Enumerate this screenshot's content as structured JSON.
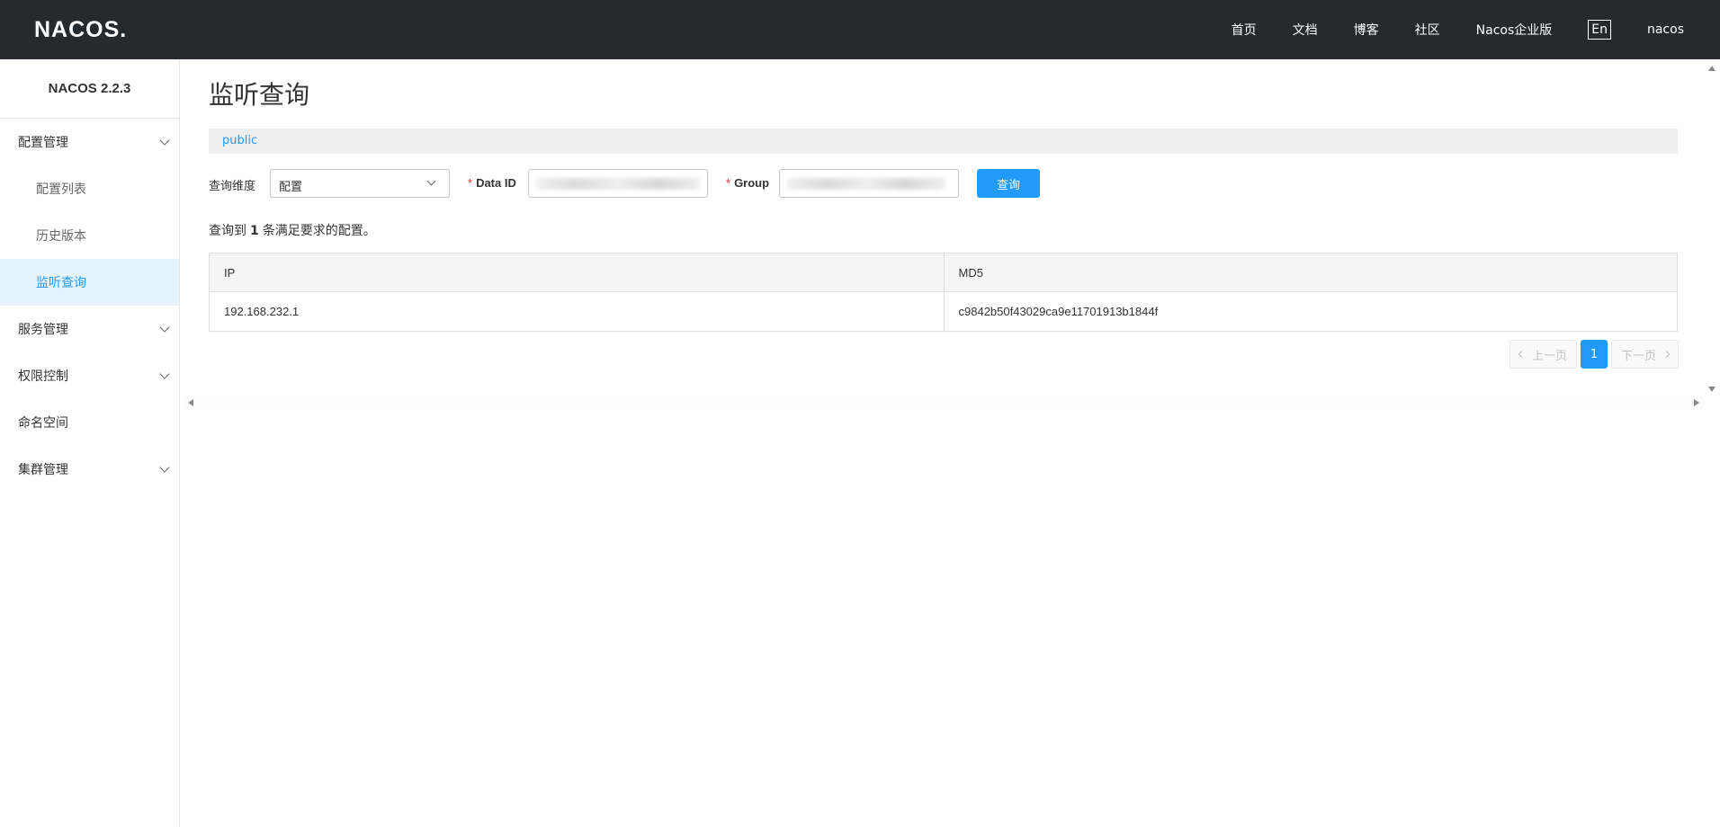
{
  "header": {
    "logo_text": "NACOS.",
    "nav": [
      "首页",
      "文档",
      "博客",
      "社区",
      "Nacos企业版"
    ],
    "lang_toggle": "En",
    "user": "nacos"
  },
  "sidebar": {
    "version": "NACOS 2.2.3",
    "groups": [
      {
        "label": "配置管理",
        "expanded": true,
        "items": [
          "配置列表",
          "历史版本",
          "监听查询"
        ]
      },
      {
        "label": "服务管理",
        "expanded": false
      },
      {
        "label": "权限控制",
        "expanded": false
      },
      {
        "label": "命名空间"
      },
      {
        "label": "集群管理",
        "expanded": false
      }
    ],
    "active_item": "监听查询"
  },
  "main": {
    "title": "监听查询",
    "namespace": "public",
    "form": {
      "dimension_label": "查询维度",
      "dimension_value": "配置",
      "data_id_label": "Data ID",
      "group_label": "Group",
      "required_mark": "*",
      "query_button": "查询"
    },
    "summary": {
      "prefix": "查询到",
      "count": "1",
      "suffix": "条满足要求的配置。"
    },
    "table": {
      "columns": [
        "IP",
        "MD5"
      ],
      "rows": [
        [
          "192.168.232.1",
          "c9842b50f43029ca9e11701913b1844f"
        ]
      ]
    },
    "pagination": {
      "prev": "上一页",
      "current": "1",
      "next": "下一页"
    }
  },
  "colors": {
    "topbar": "#252a2f",
    "accent": "#209bfa",
    "active_bg": "#e4f3fe",
    "required": "#e72727"
  }
}
